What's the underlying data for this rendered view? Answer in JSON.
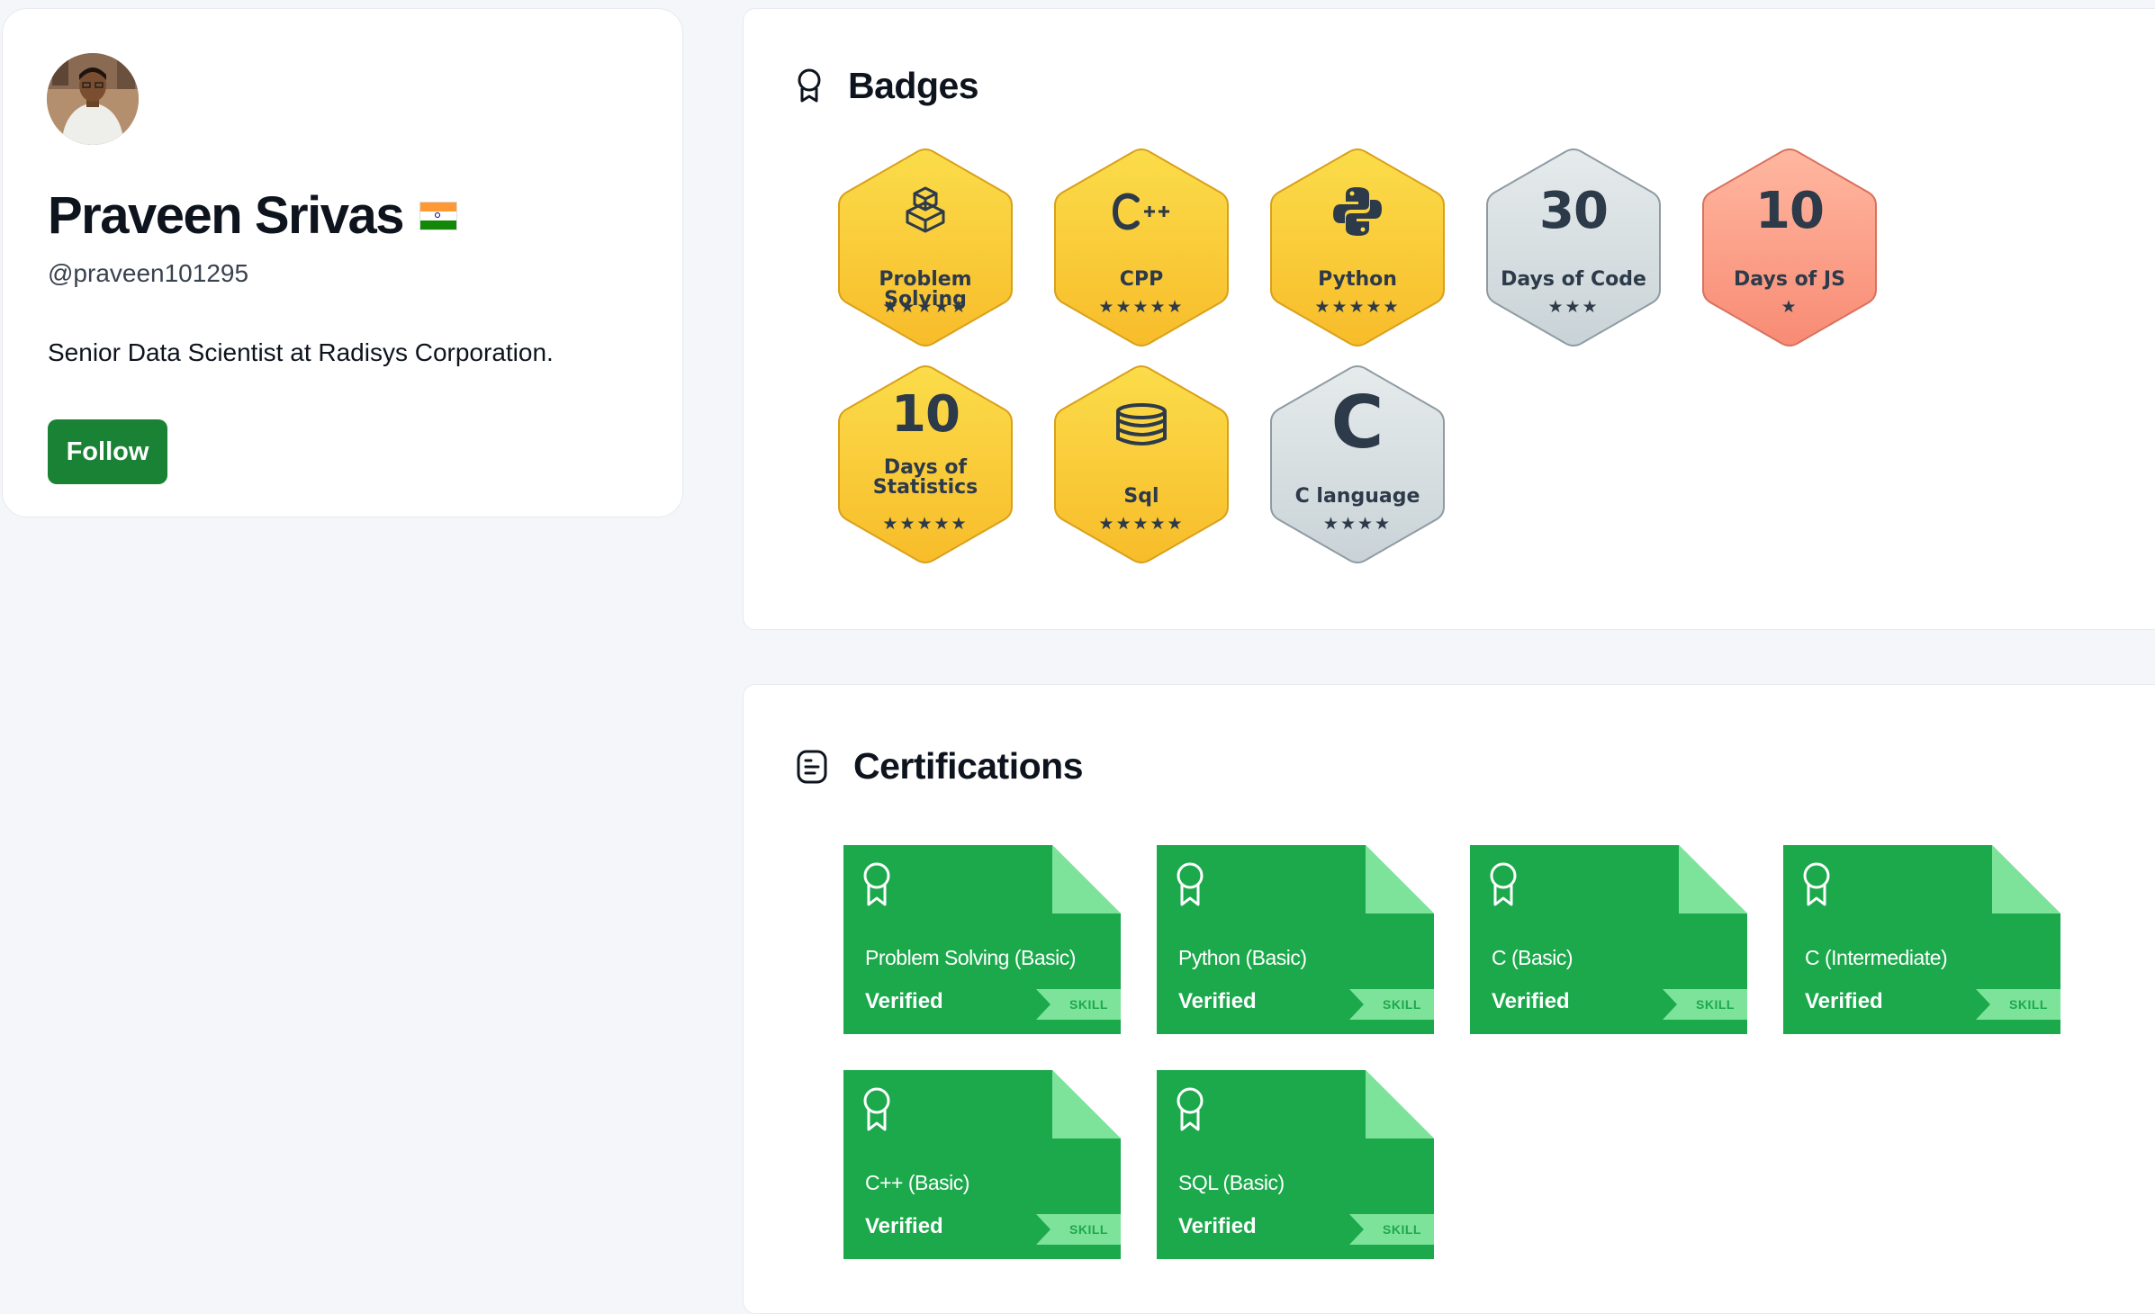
{
  "profile": {
    "name": "Praveen Srivas",
    "username": "@praveen101295",
    "bio": "Senior Data Scientist at Radisys Corporation.",
    "follow_label": "Follow",
    "country_flag": "india-flag"
  },
  "badges": {
    "title": "Badges",
    "icon": "ribbon-icon",
    "items": [
      {
        "label": "Problem Solving",
        "stars": "★★★★★",
        "icon": "cube-stack-icon",
        "tier": "gold"
      },
      {
        "label": "CPP",
        "stars": "★★★★★",
        "icon": "cpp-icon",
        "tier": "gold"
      },
      {
        "label": "Python",
        "stars": "★★★★★",
        "icon": "python-icon",
        "tier": "gold"
      },
      {
        "number": "30",
        "label": "Days of Code",
        "stars": "★★★",
        "tier": "silver"
      },
      {
        "number": "10",
        "label": "Days of JS",
        "stars": "★",
        "tier": "bronze"
      },
      {
        "number": "10",
        "label": "Days of",
        "label2": "Statistics",
        "stars": "★★★★★",
        "tier": "gold"
      },
      {
        "label": "Sql",
        "stars": "★★★★★",
        "icon": "database-icon",
        "tier": "gold"
      },
      {
        "big": "C",
        "label": "C language",
        "stars": "★★★★",
        "tier": "silver"
      }
    ]
  },
  "certifications": {
    "title": "Certifications",
    "icon": "document-icon",
    "items": [
      {
        "title": "Problem Solving (Basic)",
        "status": "Verified",
        "tag": "SKILL"
      },
      {
        "title": "Python (Basic)",
        "status": "Verified",
        "tag": "SKILL"
      },
      {
        "title": "C (Basic)",
        "status": "Verified",
        "tag": "SKILL"
      },
      {
        "title": "C (Intermediate)",
        "status": "Verified",
        "tag": "SKILL"
      },
      {
        "title": "C++ (Basic)",
        "status": "Verified",
        "tag": "SKILL"
      },
      {
        "title": "SQL (Basic)",
        "status": "Verified",
        "tag": "SKILL"
      }
    ]
  },
  "colors": {
    "follow_button": "#1a8235",
    "cert_green": "#1ba94c",
    "cert_fold": "#7ee39a",
    "gold_top": "#fbdc4a",
    "gold_bottom": "#f8bc2a",
    "silver_top": "#e6ebec",
    "silver_bottom": "#c9d3d7",
    "bronze_top": "#ffb7a0",
    "bronze_bottom": "#f88b74"
  }
}
